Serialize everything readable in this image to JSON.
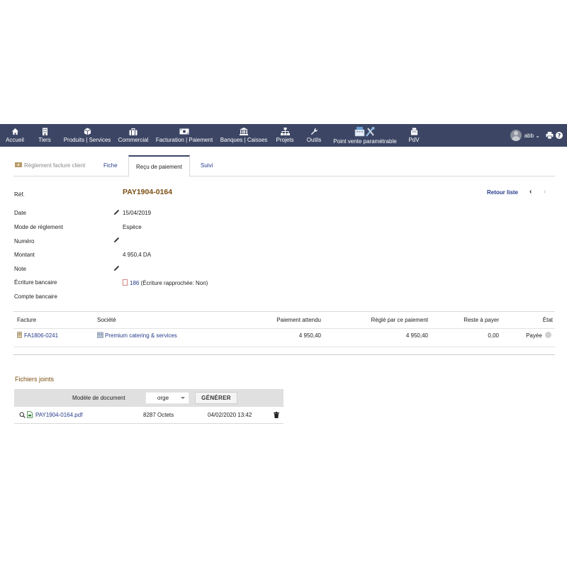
{
  "nav": {
    "items": [
      {
        "label": "Accueil",
        "icon": "home-icon"
      },
      {
        "label": "Tiers",
        "icon": "building-icon"
      },
      {
        "label": "Produits | Services",
        "icon": "box-icon"
      },
      {
        "label": "Commercial",
        "icon": "briefcase-icon"
      },
      {
        "label": "Facturation | Paiement",
        "icon": "money-icon"
      },
      {
        "label": "Banques | Caisses",
        "icon": "bank-icon"
      },
      {
        "label": "Projets",
        "icon": "sitemap-icon"
      },
      {
        "label": "Outils",
        "icon": "wrench-icon"
      },
      {
        "label": "Point vente paramétrable",
        "icon": "cash-register-icon"
      },
      {
        "label": "PdV",
        "icon": "register-icon"
      }
    ],
    "user": "abb",
    "bg_color": "#3c4664"
  },
  "tabs": {
    "first": "Règlement facture client",
    "fiche": "Fiche",
    "recu": "Reçu de paiement",
    "suivi": "Suivi"
  },
  "fields": {
    "ref_label": "Réf.",
    "ref_value": "PAY1904-0164",
    "retour": "Retour liste",
    "date_label": "Date",
    "date_value": "15/04/2019",
    "mode_label": "Mode de règlement",
    "mode_value": "Espèce",
    "numero_label": "Numéro",
    "montant_label": "Montant",
    "montant_value": "4 950,4 DA",
    "note_label": "Note",
    "ecriture_label": "Écriture bancaire",
    "ecriture_link": "186",
    "ecriture_note": "(Écriture rapprochée: Non)",
    "compte_label": "Compte bancaire"
  },
  "table": {
    "headers": {
      "facture": "Facture",
      "societe": "Société",
      "attendu": "Paiement attendu",
      "regle": "Réglé par ce paiement",
      "reste": "Reste à payer",
      "etat": "État"
    },
    "rows": [
      {
        "facture": "FA1806-0241",
        "societe": "Premium catering & services",
        "attendu": "4 950,40",
        "regle": "4 950,40",
        "reste": "0,00",
        "etat": "Payée"
      }
    ]
  },
  "files": {
    "title": "Fichiers joints",
    "model_label": "Modèle de document",
    "model_value": "orge",
    "generate": "GÉNÉRER",
    "rows": [
      {
        "name": "PAY1904-0164.pdf",
        "size": "8287 Octets",
        "date": "04/02/2020 13:42"
      }
    ]
  }
}
